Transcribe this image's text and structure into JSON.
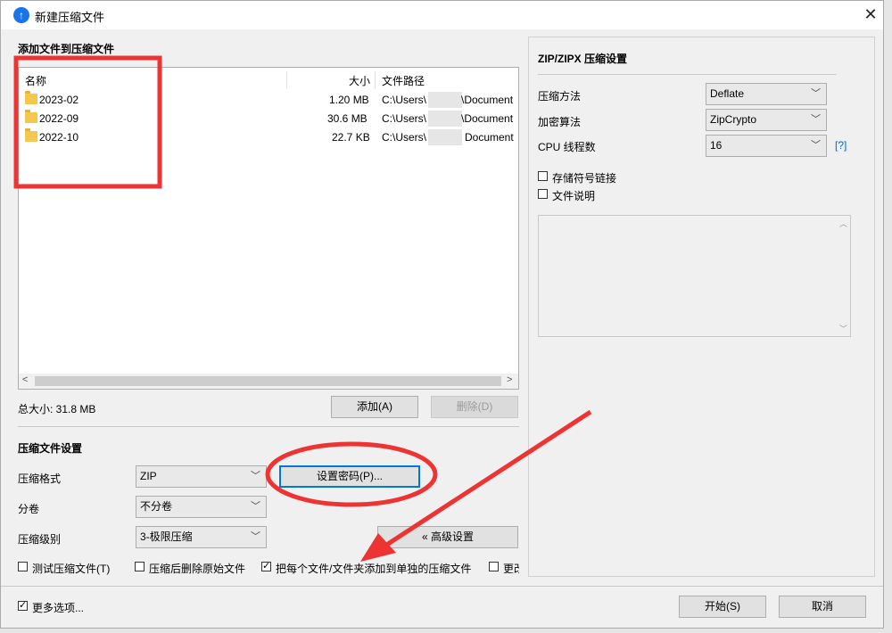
{
  "window": {
    "title": "新建压缩文件"
  },
  "files": {
    "section_title": "添加文件到压缩文件",
    "columns": {
      "name": "名称",
      "size": "大小",
      "path": "文件路径"
    },
    "rows": [
      {
        "name": "2023-02",
        "size": "1.20 MB",
        "path_prefix": "C:\\Users\\",
        "path_suffix": "\\Document"
      },
      {
        "name": "2022-09",
        "size": "30.6 MB",
        "path_prefix": "C:\\Users\\",
        "path_suffix": "\\Document"
      },
      {
        "name": "2022-10",
        "size": "22.7 KB",
        "path_prefix": "C:\\Users\\",
        "path_suffix": "Document"
      }
    ],
    "total_size": "总大小: 31.8 MB",
    "add_button": "添加(A)",
    "delete_button": "删除(D)"
  },
  "compress": {
    "section_title": "压缩文件设置",
    "format_label": "压缩格式",
    "format_value": "ZIP",
    "password_button": "设置密码(P)...",
    "split_label": "分卷",
    "split_value": "不分卷",
    "level_label": "压缩级别",
    "level_value": "3-极限压缩",
    "advanced_button": "« 高级设置",
    "checkboxes": [
      {
        "label": "测试压缩文件(T)",
        "checked": false
      },
      {
        "label": "压缩后删除原始文件",
        "checked": false
      },
      {
        "label": "把每个文件/文件夹添加到单独的压缩文件",
        "checked": true
      },
      {
        "label": "更改",
        "checked": false
      }
    ]
  },
  "zip_settings": {
    "title": "ZIP/ZIPX 压缩设置",
    "method_label": "压缩方法",
    "method_value": "Deflate",
    "encryption_label": "加密算法",
    "encryption_value": "ZipCrypto",
    "threads_label": "CPU 线程数",
    "threads_value": "16",
    "help_link": "[?]",
    "store_symlinks": "存储符号链接",
    "file_comment": "文件说明"
  },
  "footer": {
    "more_options": "更多选项...",
    "start_button": "开始(S)",
    "cancel_button": "取消"
  },
  "icons": {
    "app": "app-icon",
    "close": "close-icon",
    "folder": "folder-icon"
  },
  "colors": {
    "accent": "#0078d7",
    "folder": "#f4c84f",
    "annotation": "#ee3333"
  }
}
